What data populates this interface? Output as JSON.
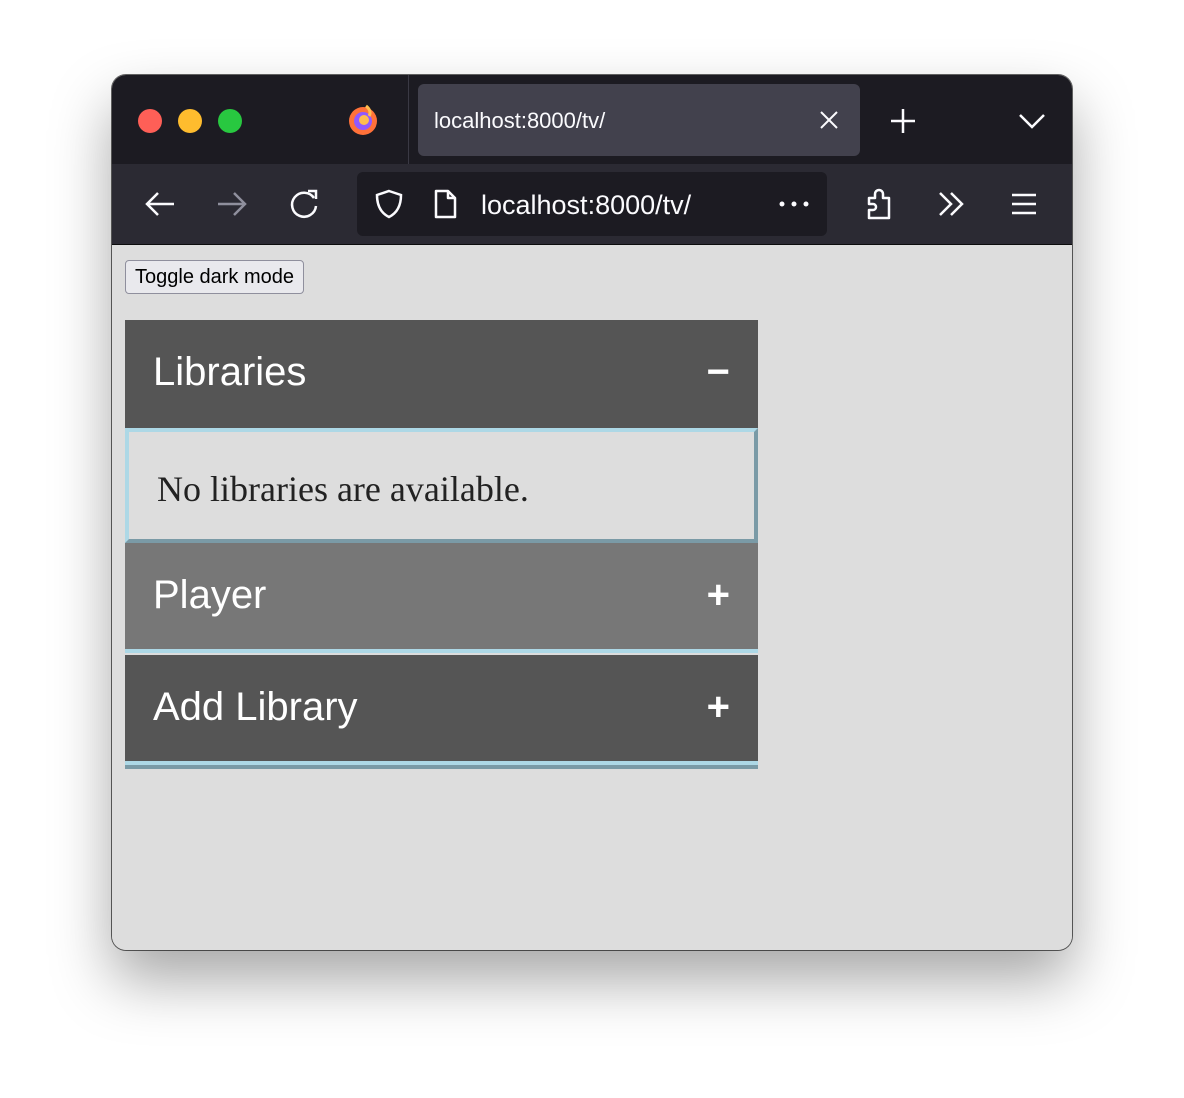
{
  "browser": {
    "tab_title": "localhost:8000/tv/",
    "url": "localhost:8000/tv/"
  },
  "page": {
    "toggle_label": "Toggle dark mode",
    "sections": [
      {
        "title": "Libraries",
        "sign": "−",
        "expanded": true,
        "body": "No libraries are available."
      },
      {
        "title": "Player",
        "sign": "+",
        "expanded": false
      },
      {
        "title": "Add Library",
        "sign": "+",
        "expanded": false
      }
    ]
  },
  "colors": {
    "header_dark": "#555555",
    "header_hover": "#777777",
    "accent_border": "#add8e6",
    "page_bg": "#dddddd"
  }
}
